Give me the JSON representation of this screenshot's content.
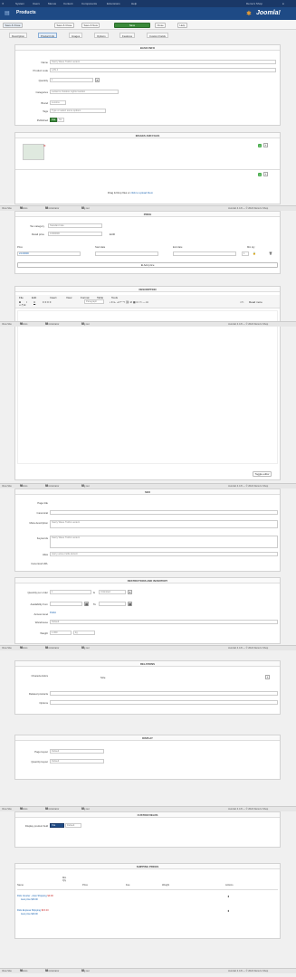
{
  "topbar": {
    "items": [
      "System",
      "Users",
      "Menus",
      "Content",
      "Components",
      "Extensions",
      "Help"
    ],
    "user": "Demo's Shop"
  },
  "header": {
    "title": "Products",
    "brand": "Joomla!"
  },
  "toolbar": {
    "buttons": [
      "Save & Close",
      "Save & New",
      "Save as Copy",
      "Save",
      "Close",
      "Help"
    ],
    "chip": "Save & Close"
  },
  "tabs": [
    "Description",
    "Product Info",
    "Images",
    "Options",
    "Features",
    "Custom Fields"
  ],
  "colors": {
    "header": "#1e4a85",
    "topbar": "#1a3867",
    "save": "#3a8a3a"
  },
  "basic": {
    "title": "BASIC INFO",
    "fields": [
      {
        "label": "Name",
        "value": "Starry Wave Trellis Lantern"
      },
      {
        "label": "Product code",
        "value": "LAN-1"
      },
      {
        "label": "Quantity",
        "value": "1"
      },
      {
        "label": "Categories",
        "value": "Lanterns  Outdoor Lights  Garden"
      },
      {
        "label": "Brand",
        "value": "Lumina"
      },
      {
        "label": "Tags",
        "value": "Type or select some options"
      },
      {
        "label": "Published",
        "value": "Yes"
      }
    ],
    "published_options": [
      "Yes",
      "No"
    ]
  },
  "images": {
    "title": "IMAGES AND FILES",
    "dropzone": "Drag & Drop files or",
    "dropzone_link": "click to upload them"
  },
  "price": {
    "title": "PRICE",
    "tax_label": "Tax category",
    "tax_value": "Standard rate",
    "price_label": "Retail price",
    "price_value": "0.000000",
    "currency": "EUR",
    "columns": [
      "Price",
      "Start date",
      "End date",
      "Min qty"
    ],
    "row": [
      "24.00000",
      "",
      "",
      "1"
    ],
    "add_button": "Add price"
  },
  "description": {
    "title": "DESCRIPTION",
    "menu": [
      "File",
      "Edit",
      "Insert",
      "View",
      "Format",
      "Table",
      "Tools"
    ],
    "toggle": "Toggle editor",
    "readmore": "Read more",
    "paragraph": "Paragraph"
  },
  "meta": {
    "title": "SEO",
    "fields": [
      {
        "label": "Page title",
        "value": ""
      },
      {
        "label": "Canonical",
        "value": ""
      },
      {
        "label": "Meta description",
        "value": "Starry Wave Trellis Lantern"
      },
      {
        "label": "Keywords",
        "value": "Starry Wave Trellis Lantern"
      },
      {
        "label": "Alias",
        "value": "starry-wave-trellis-lantern"
      },
      {
        "label": "Canonical URL",
        "value": ""
      }
    ]
  },
  "stock": {
    "title": "RESTRICTIONS AND INVENTORY",
    "qty_label": "Quantity per order",
    "qty_min": "1",
    "qty_max": "Unlimited",
    "avail_label": "Availability from",
    "to_label": "To",
    "access_label": "Access level",
    "access_value": "Public",
    "warehouse_label": "Warehouse",
    "warehouse_value": "Default",
    "weight_label": "Weight",
    "weight_value": "1.000",
    "weight_unit": "kg"
  },
  "relations": {
    "title": "RELATIONS",
    "related_label": "Characteristics",
    "related_value": "Size",
    "bundled_label": "Related products",
    "options_label": "Options"
  },
  "display": {
    "title": "DISPLAY",
    "layout_label": "Page layout",
    "layout_value": "Default",
    "quantity_label": "Quantity layout",
    "quantity_value": "Default"
  },
  "custom": {
    "title": "CUSTOM FIELDS",
    "label": "Display product field",
    "options": [
      "Yes",
      "Default"
    ]
  },
  "shipping": {
    "title": "SHIPPING PRICES",
    "columns": [
      "Name",
      "Min Qty",
      "Price",
      "Fee",
      "Weight",
      "Actions"
    ],
    "rows": [
      {
        "name": "DHL Courier - Auto Shipping",
        "price": "$9.90",
        "note": "Auto price $39.00"
      },
      {
        "name": "DHL Express Shipping",
        "price": "$15.00",
        "note": "Auto price $49.00"
      }
    ]
  },
  "statusbar": {
    "left": [
      "View Site",
      "Visitors",
      "Administrator",
      "Log out"
    ],
    "counts": [
      "0",
      "0",
      "0"
    ],
    "right": "Joomla! 4.4.8 — © 2024 Demo's Shop"
  }
}
